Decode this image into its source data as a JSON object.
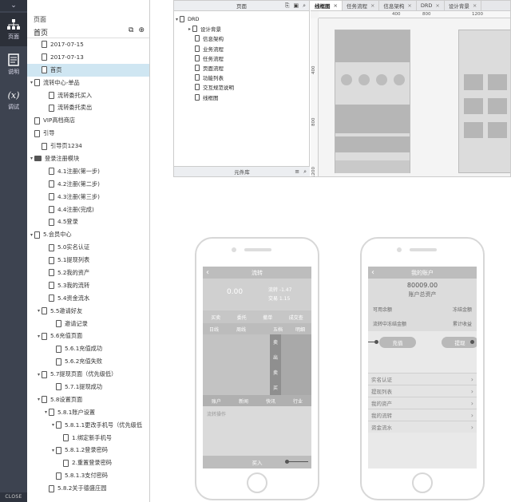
{
  "rail": {
    "top_icon": "chevron-down-icon",
    "buttons": [
      {
        "label": "页面",
        "icon": "sitemap-icon"
      },
      {
        "label": "说明",
        "icon": "document-icon"
      },
      {
        "label": "调试",
        "icon": "variable-icon",
        "glyph": "(x)"
      }
    ],
    "close_label": "CLOSE"
  },
  "tree": {
    "panel_title": "页面",
    "current_page": "首页",
    "rows": [
      {
        "label": "2017-07-15",
        "indent": 1,
        "kind": "page"
      },
      {
        "label": "2017-07-13",
        "indent": 1,
        "kind": "page"
      },
      {
        "label": "首页",
        "indent": 1,
        "kind": "page",
        "selected": true
      },
      {
        "label": "流转中心-单品",
        "indent": 0,
        "kind": "page",
        "arrow": "▾"
      },
      {
        "label": "流转委托买入",
        "indent": 2,
        "kind": "page"
      },
      {
        "label": "流转委托卖出",
        "indent": 2,
        "kind": "page"
      },
      {
        "label": "VIP高档商店",
        "indent": 0,
        "kind": "page"
      },
      {
        "label": "引导",
        "indent": 0,
        "kind": "page"
      },
      {
        "label": "引导页1234",
        "indent": 1,
        "kind": "page"
      },
      {
        "label": "登录注册模块",
        "indent": 0,
        "kind": "folder",
        "arrow": "▾"
      },
      {
        "label": "4.1注册(第一步)",
        "indent": 2,
        "kind": "page"
      },
      {
        "label": "4.2注册(第二步)",
        "indent": 2,
        "kind": "page"
      },
      {
        "label": "4.3注册(第三步)",
        "indent": 2,
        "kind": "page"
      },
      {
        "label": "4.4注册(完成)",
        "indent": 2,
        "kind": "page"
      },
      {
        "label": "4.5登录",
        "indent": 2,
        "kind": "page"
      },
      {
        "label": "5.会员中心",
        "indent": 0,
        "kind": "page",
        "arrow": "▾"
      },
      {
        "label": "5.0实名认证",
        "indent": 2,
        "kind": "page"
      },
      {
        "label": "5.1提现列表",
        "indent": 2,
        "kind": "page"
      },
      {
        "label": "5.2我的资产",
        "indent": 2,
        "kind": "page"
      },
      {
        "label": "5.3我的流转",
        "indent": 2,
        "kind": "page"
      },
      {
        "label": "5.4资金流水",
        "indent": 2,
        "kind": "page"
      },
      {
        "label": "5.5邀请好友",
        "indent": 1,
        "kind": "page",
        "arrow": "▾"
      },
      {
        "label": "邀请记录",
        "indent": 3,
        "kind": "page"
      },
      {
        "label": "5.6充值页面",
        "indent": 1,
        "kind": "page",
        "arrow": "▾"
      },
      {
        "label": "5.6.1充值成功",
        "indent": 3,
        "kind": "page"
      },
      {
        "label": "5.6.2充值失败",
        "indent": 3,
        "kind": "page"
      },
      {
        "label": "5.7提现页面（优先级低）",
        "indent": 1,
        "kind": "page",
        "arrow": "▾"
      },
      {
        "label": "5.7.1提现成功",
        "indent": 3,
        "kind": "page"
      },
      {
        "label": "5.8设置页面",
        "indent": 1,
        "kind": "page",
        "arrow": "▾"
      },
      {
        "label": "5.8.1账户设置",
        "indent": 2,
        "kind": "page",
        "arrow": "▾"
      },
      {
        "label": "5.8.1.1更改手机号（优先级低",
        "indent": 3,
        "kind": "page",
        "arrow": "▾"
      },
      {
        "label": "1.绑定新手机号",
        "indent": 4,
        "kind": "page"
      },
      {
        "label": "5.8.1.2登录密码",
        "indent": 3,
        "kind": "page",
        "arrow": "▾"
      },
      {
        "label": "2.重置登录密码",
        "indent": 4,
        "kind": "page"
      },
      {
        "label": "5.8.1.3支付密码",
        "indent": 3,
        "kind": "page"
      },
      {
        "label": "5.8.2关于德盛庄园",
        "indent": 2,
        "kind": "page"
      }
    ]
  },
  "editor": {
    "pages_title": "页面",
    "root": "DRD",
    "rows": [
      "设计背景",
      "信息架构",
      "业务流程",
      "任务流程",
      "页面流程",
      "功能列表",
      "交互规范说明",
      "线框图"
    ],
    "library_title": "元件库",
    "tabs": [
      {
        "label": "线框图",
        "active": true
      },
      {
        "label": "任务流程"
      },
      {
        "label": "信息架构"
      },
      {
        "label": "DRD"
      },
      {
        "label": "设计背景"
      }
    ],
    "ruler_h": [
      "400",
      "800",
      "1200"
    ],
    "ruler_v": [
      "400",
      "800",
      "1200"
    ]
  },
  "phone1": {
    "title": "流转",
    "value": "0.00",
    "stats": [
      "流转 -1.47",
      "交易 1.15"
    ],
    "menu": [
      "买卖",
      "委托",
      "撤单",
      "成交查"
    ],
    "tabs": [
      "日线",
      "周线",
      "五档",
      "明细"
    ],
    "side": [
      "卖",
      "出",
      "",
      "卖",
      "买"
    ],
    "bottom": [
      "账户",
      "新闻",
      "快讯",
      "行业"
    ],
    "note": "流转操作",
    "footer": "买入"
  },
  "phone2": {
    "title": "我的账户",
    "amount": "80009.00",
    "amount_label": "账户总资产",
    "hero_left": "可用余额",
    "hero_right": "冻结金额",
    "hero_left2": "流转中冻结金额",
    "hero_right2": "累计收益",
    "btn_left": "充值",
    "btn_right": "提现",
    "list": [
      "实名认证",
      "提现列表",
      "我的资产",
      "我的流转",
      "资金流水"
    ]
  }
}
